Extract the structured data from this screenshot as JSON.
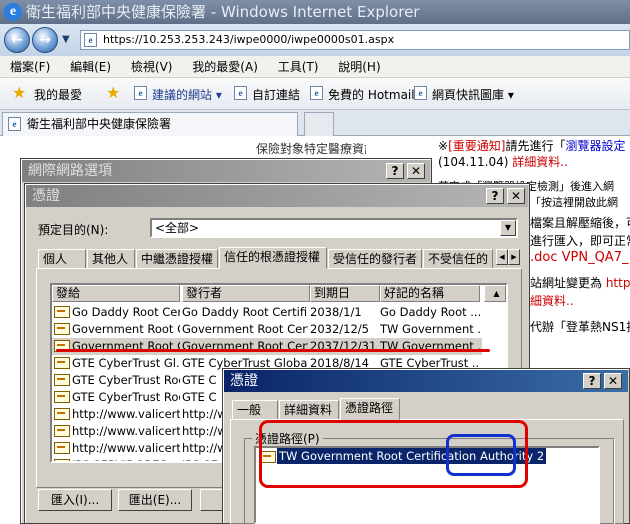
{
  "browser": {
    "title": "衛生福利部中央健康保險署 - Windows Internet Explorer",
    "address": "https://10.253.253.243/iwpe0000/iwpe0000s01.aspx",
    "menu": [
      "檔案(F)",
      "編輯(E)",
      "檢視(V)",
      "我的最愛(A)",
      "工具(T)",
      "說明(H)"
    ],
    "favorites_label": "我的最愛",
    "fav_links": [
      "建議的網站 ▾",
      "自訂連結",
      "免費的 Hotmail",
      "網頁快訊圖庫 ▾"
    ],
    "tab_title": "衛生福利部中央健康保險署"
  },
  "page": {
    "line1_prefix": "※",
    "line1_notice": "[重要通知]",
    "line1_text": "請先進行「",
    "line1_link": "瀏覽器設定",
    "line2_date": "(104.11.04)",
    "line2_link": "詳細資料..",
    "line3": "若完成「瀏覽器設定檢測」後進入網",
    "line4": "「按這裡開啟此網",
    "line5": "檔案且解壓縮後，可",
    "line6": "進行匯入，即可正常",
    "line7": ".doc VPN_QA7_",
    "line8_text": "站網址變更為 ",
    "line8_link": "http",
    "line9": "細資料..",
    "line10": "代辦「登革熱NS1抗",
    "line11": "保險對象特定醫療資訊查詢作業",
    "line12": "..."
  },
  "internet_options": {
    "title": "網際網路選項",
    "help": "?",
    "close": "✕"
  },
  "certificates": {
    "title": "憑證",
    "help": "?",
    "close": "✕",
    "purpose_label": "預定目的(N):",
    "purpose_value": "<全部>",
    "tabs": [
      "個人",
      "其他人",
      "中繼憑證授權",
      "信任的根憑證授權",
      "受信任的發行者",
      "不受信任的"
    ],
    "columns": [
      "發給",
      "發行者",
      "到期日",
      "好記的名稱"
    ],
    "rows": [
      [
        "Go Daddy Root Cert...",
        "Go Daddy Root Certifi...",
        "2038/1/1",
        "Go Daddy Root ..."
      ],
      [
        "Government Root C...",
        "Government Root Cert...",
        "2032/12/5",
        "TW Government ..."
      ],
      [
        "Government Root C...",
        "Government Root Cert...",
        "2037/12/31",
        "TW Government ..."
      ],
      [
        "GTE CyberTrust Gl...",
        "GTE CyberTrust Globa...",
        "2018/8/14",
        "GTE CyberTrust ..."
      ],
      [
        "GTE CyberTrust Root",
        "GTE C",
        "",
        ""
      ],
      [
        "GTE CyberTrust Root",
        "GTE C",
        "",
        ""
      ],
      [
        "http://www.valicert.c...",
        "http://w",
        "",
        ""
      ],
      [
        "http://www.valicert.c...",
        "http://w",
        "",
        ""
      ],
      [
        "http://www.valicert.c...",
        "http://w",
        "",
        ""
      ],
      [
        "IPS SERVIDORES",
        "IPS SE",
        "",
        ""
      ]
    ],
    "import_btn": "匯入(I)...",
    "export_btn": "匯出(E)..."
  },
  "cert_detail": {
    "title": "憑證",
    "help": "?",
    "close": "✕",
    "tabs": [
      "一般",
      "詳細資料",
      "憑證路徑"
    ],
    "path_label": "憑證路徑(P)",
    "path_item": "TW Government Root Certification Authority 2"
  },
  "annotation_colors": {
    "red": "#e00000",
    "blue": "#1030d0"
  }
}
